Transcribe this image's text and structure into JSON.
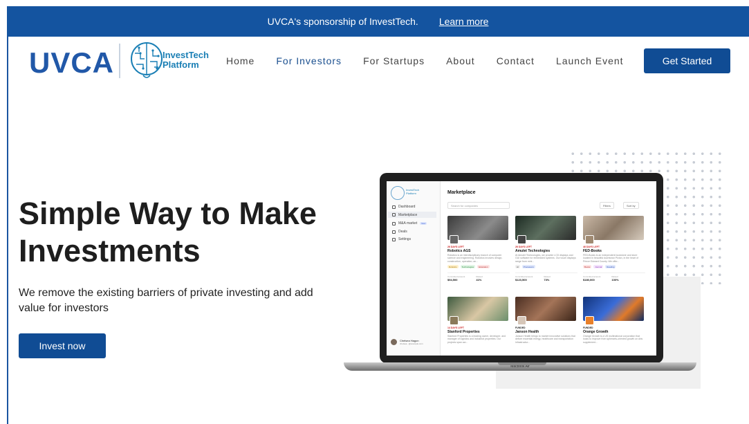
{
  "announcement": {
    "message": "UVCA's sponsorship of InvestTech.",
    "link": "Learn more"
  },
  "header": {
    "logo_main": "UVCA",
    "logo_sub_line1": "InvestTech",
    "logo_sub_line2": "Platform",
    "nav": [
      "Home",
      "For Investors",
      "For Startups",
      "About",
      "Contact",
      "Launch Event"
    ],
    "active_nav": "For Investors",
    "cta": "Get Started"
  },
  "hero": {
    "title": "Simple Way to Make Investments",
    "subtitle": "We remove the existing barriers of private investing and add value for investors",
    "button": "Invest now"
  },
  "mockup": {
    "device_label": "Macbook Air",
    "sidebar": {
      "logo_line1": "InvestTech",
      "logo_line2": "Platform",
      "items": [
        "Dashboard",
        "Marketplace",
        "M&A market",
        "Deals",
        "Settings"
      ],
      "new_badge": "New",
      "user_name": "Chelsea Hagon",
      "user_email": "chelsea...@example.com"
    },
    "title": "Marketplace",
    "search_placeholder": "Search for companies",
    "filters": "Filters",
    "sort": "Sort by",
    "cards": [
      {
        "status": "26 DAYS LEFT",
        "name": "Robotics AGS",
        "desc": "Robotics is an interdisciplinary branch of computer science and engineering. Robotics involves design, construction, operation, an...",
        "tags": [
          "Robotics",
          "Technologies",
          "Education"
        ],
        "raised_label": "Committed amount",
        "raised": "$94,500",
        "pct_label": "Raised",
        "pct": "41%"
      },
      {
        "status": "26 DAYS LEFT",
        "name": "Amulet Technologies",
        "desc": "At Amulet Technologies, we provide LCD displays and GUI software for embedded systems. Our touch displays range from mini...",
        "tags": [
          "AI",
          "Processors"
        ],
        "raised_label": "Committed amount",
        "raised": "$123,500",
        "pct_label": "Raised",
        "pct": "73%"
      },
      {
        "status": "46 DAYS LEFT",
        "name": "FED-Books",
        "desc": "FED-Books is an independent bookstore and store located in beautiful downtown Picton, in the heart of Prince Edward County. We offer...",
        "tags": [
          "Books",
          "Journal",
          "Reading"
        ],
        "raised_label": "Committed amount",
        "raised": "$180,000",
        "pct_label": "Raised",
        "pct": "100%"
      },
      {
        "status": "14 DAYS LEFT",
        "name": "Stanford Properties",
        "desc": "Stanford Properties is a leading owner, developer, and manager of logistics and industrial properties. Our projects span acr...",
        "tags": [],
        "raised_label": "",
        "raised": "",
        "pct_label": "",
        "pct": ""
      },
      {
        "status": "FUNDED",
        "name": "Janson Health",
        "desc": "Janson Health brings to market innovative solutions that deliver essential energy, healthcare and transportation infrastructur...",
        "tags": [],
        "raised_label": "",
        "raised": "",
        "pct_label": "",
        "pct": ""
      },
      {
        "status": "FUNDED",
        "name": "Orange Growth",
        "desc": "Orange Growth is a US multinational corporation that looks to improve from spherarts-oriented growth on Arts supplement...",
        "tags": [],
        "raised_label": "",
        "raised": "",
        "pct_label": "",
        "pct": ""
      }
    ]
  },
  "colors": {
    "brand_blue": "#104c94",
    "topbar_blue": "#1454a0",
    "logo_blue": "#2158a8",
    "logo_teal": "#1a7fb5"
  }
}
